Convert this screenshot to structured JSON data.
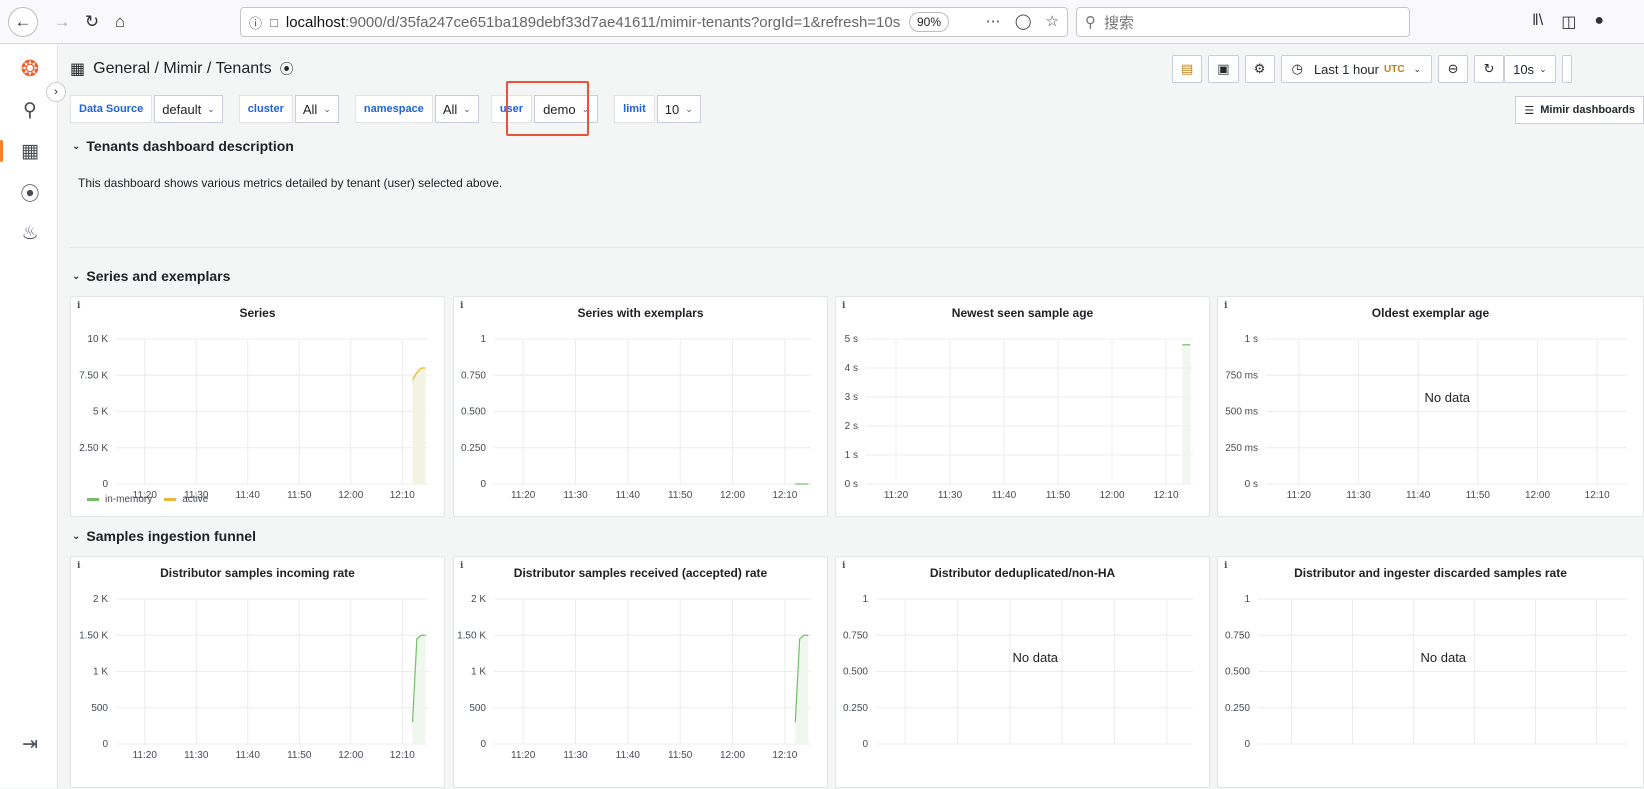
{
  "browser": {
    "url_host": "localhost",
    "url_rest": ":9000/d/35fa247ce651ba189debf33d7ae41611/mimir-tenants?orgId=1&refresh=10s",
    "zoom": "90%",
    "search_placeholder": "搜索"
  },
  "header": {
    "breadcrumb": "General  / Mimir / Tenants",
    "time_range": "Last 1 hour",
    "timezone": "UTC",
    "refresh": "10s"
  },
  "variables": [
    {
      "label": "Data Source",
      "value": "default"
    },
    {
      "label": "cluster",
      "value": "All"
    },
    {
      "label": "namespace",
      "value": "All"
    },
    {
      "label": "user",
      "value": "demo"
    },
    {
      "label": "limit",
      "value": "10"
    }
  ],
  "dashboard_links": "Mimir dashboards",
  "rows": {
    "description": {
      "title": "Tenants dashboard description",
      "text": "This dashboard shows various metrics detailed by tenant (user) selected above."
    },
    "series": {
      "title": "Series and exemplars"
    },
    "funnel": {
      "title": "Samples ingestion funnel"
    }
  },
  "no_data_text": "No data",
  "colors": {
    "green": "#73bf69",
    "yellow": "#eab839",
    "fill_green": "#eef6ec",
    "fill_yellow": "#f4f1df"
  },
  "chart_data": [
    {
      "type": "line",
      "title": "Series",
      "x": [
        "11:20",
        "11:30",
        "11:40",
        "11:50",
        "12:00",
        "12:10"
      ],
      "y_ticks": [
        "10 K",
        "7.50 K",
        "5 K",
        "2.50 K",
        "0"
      ],
      "ylim": [
        0,
        10000
      ],
      "series": [
        {
          "name": "in-memory",
          "values_from_12_12": [
            7000,
            7600,
            7900,
            8000
          ]
        },
        {
          "name": "active",
          "values_from_12_12": [
            7200,
            7700,
            8000,
            8000
          ]
        }
      ]
    },
    {
      "type": "line",
      "title": "Series with exemplars",
      "x": [
        "11:20",
        "11:30",
        "11:40",
        "11:50",
        "12:00",
        "12:10"
      ],
      "y_ticks": [
        "1",
        "0.750",
        "0.500",
        "0.250",
        "0"
      ],
      "ylim": [
        0,
        1
      ],
      "series": [
        {
          "values_from_12_12": [
            0,
            0
          ]
        }
      ]
    },
    {
      "type": "area",
      "title": "Newest seen sample age",
      "x": [
        "11:20",
        "11:30",
        "11:40",
        "11:50",
        "12:00",
        "12:10"
      ],
      "y_ticks": [
        "5 s",
        "4 s",
        "3 s",
        "2 s",
        "1 s",
        "0 s"
      ],
      "ylim": [
        0,
        5
      ],
      "series": [
        {
          "values_from_12_13": [
            4.8,
            4.8
          ]
        }
      ]
    },
    {
      "type": "line",
      "title": "Oldest exemplar age",
      "x": [
        "11:20",
        "11:30",
        "11:40",
        "11:50",
        "12:00",
        "12:10"
      ],
      "y_ticks": [
        "1 s",
        "750 ms",
        "500 ms",
        "250 ms",
        "0 s"
      ],
      "ylim": [
        0,
        1
      ],
      "series": []
    },
    {
      "type": "area",
      "title": "Distributor samples incoming rate",
      "x": [
        "11:20",
        "11:30",
        "11:40",
        "11:50",
        "12:00",
        "12:10"
      ],
      "y_ticks": [
        "2 K",
        "1.50 K",
        "1 K",
        "500",
        "0"
      ],
      "ylim": [
        0,
        2000
      ],
      "series": [
        {
          "values_from_12_12": [
            300,
            1450,
            1500,
            1500
          ]
        }
      ]
    },
    {
      "type": "area",
      "title": "Distributor samples received (accepted) rate",
      "x": [
        "11:20",
        "11:30",
        "11:40",
        "11:50",
        "12:00",
        "12:10"
      ],
      "y_ticks": [
        "2 K",
        "1.50 K",
        "1 K",
        "500",
        "0"
      ],
      "ylim": [
        0,
        2000
      ],
      "series": [
        {
          "values_from_12_12": [
            300,
            1450,
            1500,
            1500
          ]
        }
      ]
    },
    {
      "type": "line",
      "title": "Distributor deduplicated/non-HA",
      "x": [],
      "y_ticks": [
        "1",
        "0.750",
        "0.500",
        "0.250",
        "0"
      ],
      "ylim": [
        0,
        1
      ],
      "series": []
    },
    {
      "type": "line",
      "title": "Distributor and ingester discarded samples rate",
      "x": [],
      "y_ticks": [
        "1",
        "0.750",
        "0.500",
        "0.250",
        "0"
      ],
      "ylim": [
        0,
        1
      ],
      "series": []
    }
  ]
}
